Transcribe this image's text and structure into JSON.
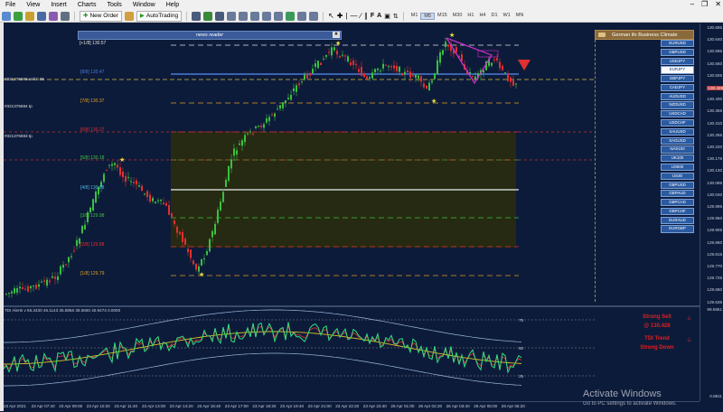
{
  "menu": [
    "File",
    "View",
    "Insert",
    "Charts",
    "Tools",
    "Window",
    "Help"
  ],
  "toolbar": {
    "new_order": "New Order",
    "autotrading": "AutoTrading",
    "timeframes": [
      "M1",
      "M5",
      "M15",
      "M30",
      "H1",
      "H4",
      "D1",
      "W1",
      "MN"
    ],
    "active_tf": "M5"
  },
  "news_reader": {
    "title": "news reader",
    "close": "✖"
  },
  "fib_levels": [
    {
      "label": "[+1/8]",
      "value": "130.57",
      "color": "#e0e0e0"
    },
    {
      "label": "[8/8]",
      "value": "130.47",
      "color": "#4a7ad8"
    },
    {
      "label": "[7/8]",
      "value": "130.37",
      "color": "#e0a020"
    },
    {
      "label": "[6/8]",
      "value": "130.27",
      "color": "#e03030"
    },
    {
      "label": "[5/8]",
      "value": "130.18",
      "color": "#40c040"
    },
    {
      "label": "[4/8]",
      "value": "130.08",
      "color": "#4ab8e8"
    },
    {
      "label": "[3/8]",
      "value": "129.98",
      "color": "#40c040"
    },
    {
      "label": "[2/8]",
      "value": "129.88",
      "color": "#e03030"
    },
    {
      "label": "[1/8]",
      "value": "129.79",
      "color": "#e0a020"
    }
  ],
  "orders": [
    {
      "text": "#321376698 sell 0.05"
    },
    {
      "text": "#321376694 tp"
    },
    {
      "text": "#321376693 tp"
    }
  ],
  "ifo_panel": {
    "title": "German ifo Business Climate"
  },
  "pairs": [
    "EURUSD",
    "GBPUSD",
    "USDJPY",
    "EURJPY",
    "GBPJPY",
    "CADJPY",
    "AUDUSD",
    "NZDUSD",
    "USDCAD",
    "USDCHF",
    "XAUUSD",
    "XAGUSD",
    "NAS100",
    "UK100",
    "US500",
    "US30",
    "GBPUSD",
    "GBPAUD",
    "GBPCAD",
    "GBPCHF",
    "EURAUD",
    "EURGBP"
  ],
  "selected_pair": "EURJPY",
  "price_axis": [
    "130.685",
    "130.640",
    "130.595",
    "130.550",
    "130.505",
    "130.445",
    "130.400",
    "130.355",
    "130.310",
    "130.265",
    "130.220",
    "130.175",
    "130.130",
    "130.085",
    "130.040",
    "129.995",
    "129.950",
    "129.905",
    "129.860",
    "129.815",
    "129.770",
    "129.725",
    "129.680",
    "129.635"
  ],
  "current_price": "130.428",
  "ind_axis": [
    "99.5851",
    "75",
    "50",
    "25",
    "0.8811"
  ],
  "indicator_label": "TDI Alerts v 56.3430 46.1143 35.8856 38.5660 40.9474 0.0000",
  "signals": {
    "sell": "Strong Sell",
    "sell_price": "@ 130.428",
    "trend": "TDI Trend",
    "trend_dir": "Strong Down"
  },
  "time_axis": [
    "23 Apr 2021",
    "23 Apr 07:40",
    "23 Apr 09:00",
    "23 Apr 10:20",
    "23 Apr 11:40",
    "23 Apr 13:00",
    "23 Apr 14:20",
    "23 Apr 15:40",
    "23 Apr 17:00",
    "23 Apr 18:20",
    "23 Apr 19:40",
    "23 Apr 21:00",
    "23 Apr 22:20",
    "23 Apr 23:40",
    "26 Apr 01:00",
    "26 Apr 02:20",
    "26 Apr 03:40",
    "26 Apr 05:00",
    "26 Apr 06:20"
  ],
  "windows": {
    "activate": "Activate Windows",
    "activate_sub": "Go to PC settings to activate Windows."
  }
}
